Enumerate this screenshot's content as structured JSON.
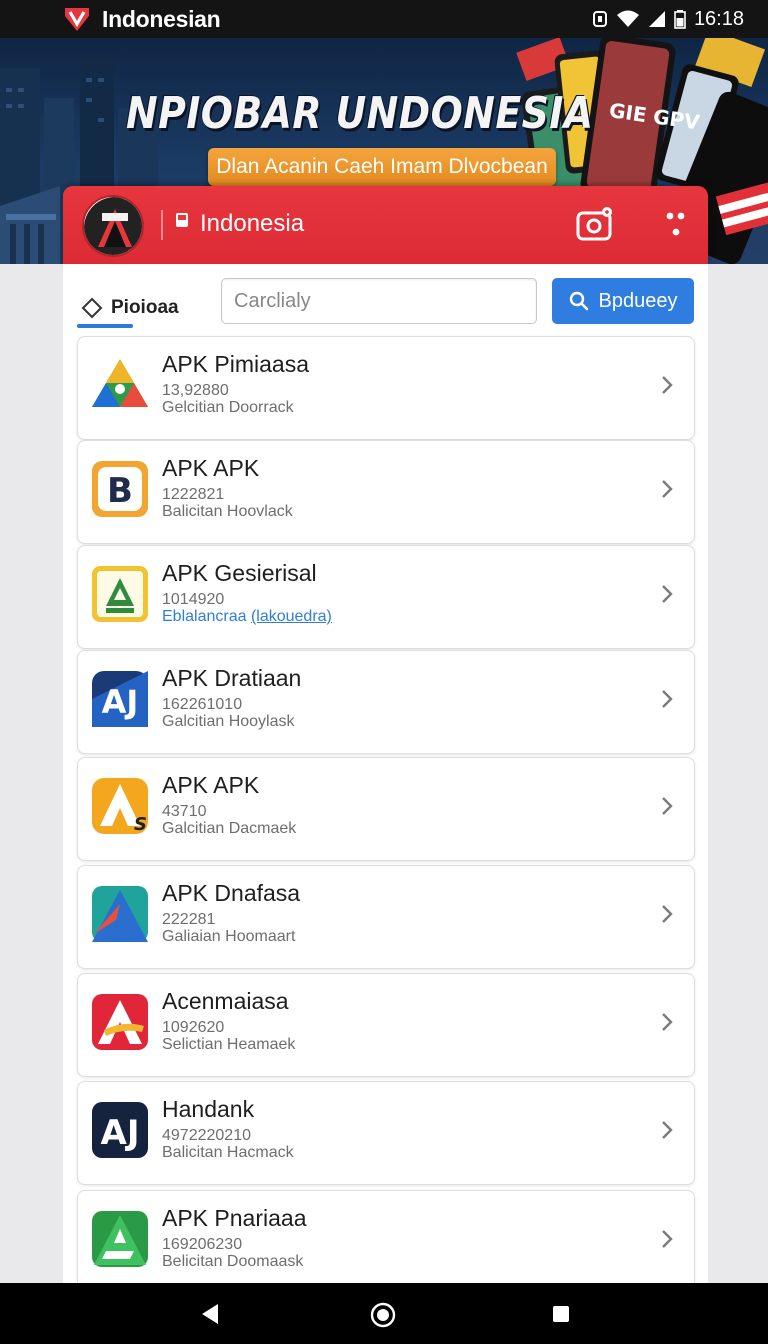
{
  "status_bar": {
    "app_title": "Indonesian",
    "time": "16:18",
    "icons": [
      "vpn-icon",
      "wifi-icon",
      "signal-icon",
      "battery-icon"
    ]
  },
  "hero": {
    "title": "NPIOBAR UNDONESIA",
    "subtitle": "Dlan Acanin Caeh Imam Dlvocbean",
    "phone_text": "GIE GPV"
  },
  "header": {
    "label": "Indonesia",
    "accent_color": "#e23039"
  },
  "toolbar": {
    "tab_label": "Pioioaa",
    "search_placeholder": "Carclialy",
    "search_button_label": "Bpdueey"
  },
  "apps": [
    {
      "title": "APK Pimiaasa",
      "count": "13,92880",
      "subtitle": "Gelcitian Doorrack",
      "link": false,
      "icon": "triangle-green-icon"
    },
    {
      "title": "APK APK",
      "count": "1222821",
      "subtitle": "Balicitan Hoovlack",
      "link": false,
      "icon": "b-letter-icon"
    },
    {
      "title": "APK Gesierisal",
      "count": "1014920",
      "subtitle": "Eblalancraa",
      "subtitle_link": "(lakouedra)",
      "link": true,
      "icon": "a-badge-icon"
    },
    {
      "title": "APK Dratiaan",
      "count": "162261010",
      "subtitle": "Galcitian Hooylask",
      "link": false,
      "icon": "aj-blue-icon"
    },
    {
      "title": "APK APK",
      "count": "43710",
      "subtitle": "Galcitian Dacmaek",
      "link": false,
      "icon": "a-yellow-icon"
    },
    {
      "title": "APK Dnafasa",
      "count": "222281",
      "subtitle": "Galiaian Hoomaart",
      "link": false,
      "icon": "a-teal-icon"
    },
    {
      "title": "Acenmaiasa",
      "count": "1092620",
      "subtitle": "Selictian Heamaek",
      "link": false,
      "icon": "a-red-icon"
    },
    {
      "title": "Handank",
      "count": "4972220210",
      "subtitle": "Balicitan Hacmack",
      "link": false,
      "icon": "aj-navy-icon"
    },
    {
      "title": "APK Pnariaaa",
      "count": "169206230",
      "subtitle": "Belicitan Doomaask",
      "link": false,
      "icon": "a-green-icon"
    }
  ],
  "nav": {
    "icons": [
      "back-icon",
      "home-icon",
      "recents-icon"
    ]
  }
}
